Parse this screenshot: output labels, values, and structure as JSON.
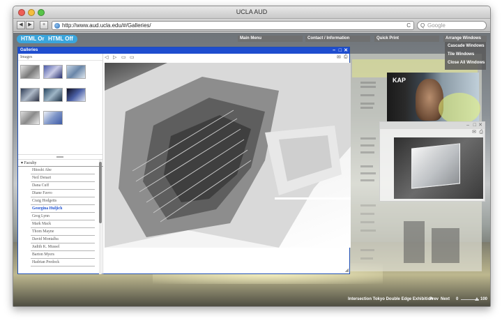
{
  "window": {
    "title": "UCLA AUD",
    "url": "http://www.aud.ucla.edu/#/Galleries/",
    "search_placeholder": "Google"
  },
  "toolbar": {
    "back": "◀",
    "forward": "▶",
    "add": "+",
    "reload": "C",
    "search_icon": "Q"
  },
  "site_nav": {
    "html_on": "HTML On",
    "html_off": "HTML Off",
    "main_menu": "Main Menu",
    "contact": "Contact / Information",
    "quick_print": "Quick Print",
    "arrange_windows": "Arrange Windows",
    "arrange_menu": [
      "Cascade Windows",
      "Tile Windows",
      "Close All Windows"
    ]
  },
  "galleries": {
    "title": "Galleries",
    "controls": {
      "minimize": "–",
      "maximize": "□",
      "close": "✕"
    },
    "images_header": "Images",
    "faculty_header": "Faculty",
    "faculty": [
      "Hitoshi Abe",
      "Neil Denari",
      "Dana Cuff",
      "Diane Favro",
      "Craig Hodgetts",
      "Georgina Huljich",
      "Greg Lynn",
      "Mark Mack",
      "Thom Mayne",
      "David Montalba",
      "Judith K. Mussel",
      "Barton Myers",
      "Hadrian Predock"
    ],
    "selected_faculty": "Georgina Huljich",
    "tools": {
      "prev": "◁",
      "play": "▷",
      "folder": "▭",
      "file": "▭",
      "mail": "✉",
      "print": "⎙"
    }
  },
  "kap": {
    "label": "KAP"
  },
  "footer": {
    "exhibit": "Intersection Tokyo Double Edge Exhibition",
    "prev": "Prev",
    "next": "Next",
    "zoom_min": "0",
    "zoom_max": "100"
  },
  "colors": {
    "accent_blue": "#1e4dcf",
    "pill_blue": "#3aa5dc",
    "selected_text": "#1b4fd1"
  }
}
